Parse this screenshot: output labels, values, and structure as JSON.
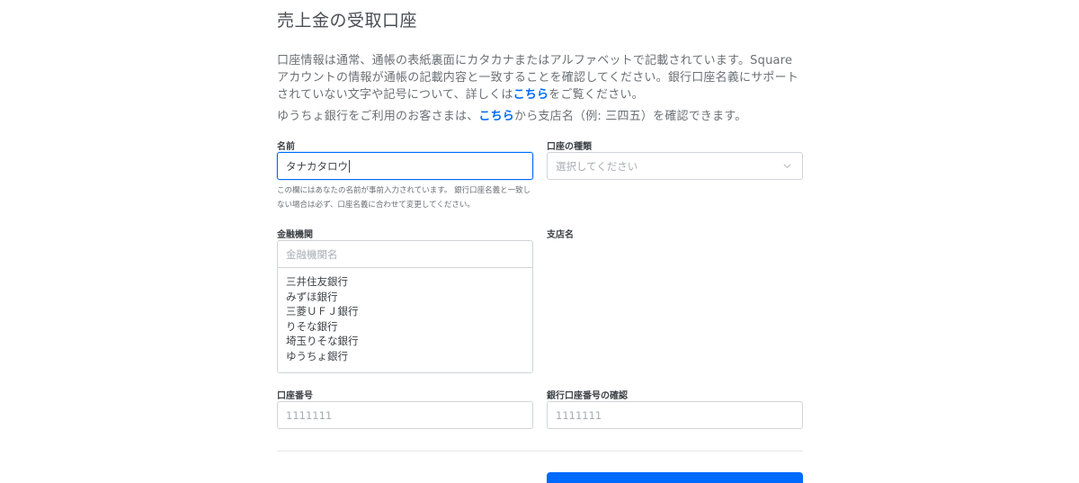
{
  "page": {
    "title": "売上金の受取口座",
    "intro": {
      "text_before": "口座情報は通常、通帳の表紙裏面にカタカナまたはアルファベットで記載されています。Squareアカウントの情報が通帳の記載内容と一致することを確認してください。銀行口座名義にサポートされていない文字や記号について、詳しくは",
      "link": "こちら",
      "text_after": "をご覧ください。"
    },
    "note": {
      "text_before": "ゆうちょ銀行をご利用のお客さまは、",
      "link": "こちら",
      "text_after": "から支店名（例: 三四五）を確認できます。"
    }
  },
  "form": {
    "name": {
      "label": "名前",
      "value": "タナカタロウ",
      "helper": "この欄にはあなたの名前が事前入力されています。 銀行口座名義と一致しない場合は必ず、口座名義に合わせて変更してください。"
    },
    "account_type": {
      "label": "口座の種類",
      "placeholder": "選択してください"
    },
    "bank": {
      "label": "金融機関",
      "placeholder": "金融機関名",
      "options": [
        "三井住友銀行",
        "みずほ銀行",
        "三菱ＵＦＪ銀行",
        "りそな銀行",
        "埼玉りそな銀行",
        "ゆうちょ銀行"
      ]
    },
    "branch": {
      "label": "支店名"
    },
    "account_number": {
      "label": "口座番号",
      "placeholder": "1111111"
    },
    "account_number_confirm": {
      "label": "銀行口座番号の確認",
      "placeholder": "1111111"
    }
  },
  "colors": {
    "accent": "#006aff",
    "text": "#3e4348",
    "muted": "#6b7075",
    "border": "#d0d4d8"
  }
}
